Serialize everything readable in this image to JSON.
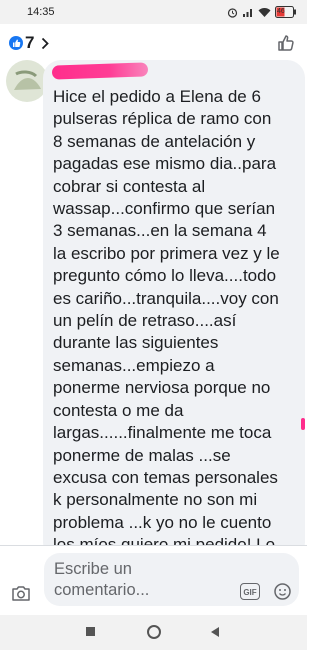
{
  "status_bar": {
    "time": "14:35",
    "battery_level": "46",
    "icons": [
      "alarm-icon",
      "signal-icon",
      "wifi-icon",
      "battery-icon"
    ]
  },
  "header": {
    "reaction_count": "7",
    "icons": [
      "like-reaction-icon",
      "chevron-right-icon",
      "thumbs-up-icon"
    ]
  },
  "comment": {
    "text": "Hice el pedido a Elena de 6\npulseras réplica de ramo con\n8 semanas de antelación y\npagadas ese mismo dia..para\ncobrar si contesta al\nwassap...confirmo que serían\n3 semanas...en la semana 4\nla escribo por primera vez y le\npregunto cómo lo lleva....todo\nes cariño...tranquila....voy con\nun pelín de retraso....así\ndurante las siguientes\nsemanas...empiezo a\nponerme nerviosa porque no\ncontesta o me da\nlargas......finalmente me toca\nponerme de malas ...se\nexcusa con temas personales\nk personalmente no son mi\nproblema ...k yo no le cuento\nlos míos quiero mi pedido! Lo"
  },
  "composer": {
    "placeholder": "Escribe un\ncomentario...",
    "gif_label": "GIF"
  },
  "colors": {
    "accent_blue": "#1877f2",
    "bubble_bg": "#f0f2f5",
    "redaction_pink": "#ff2d8c"
  }
}
